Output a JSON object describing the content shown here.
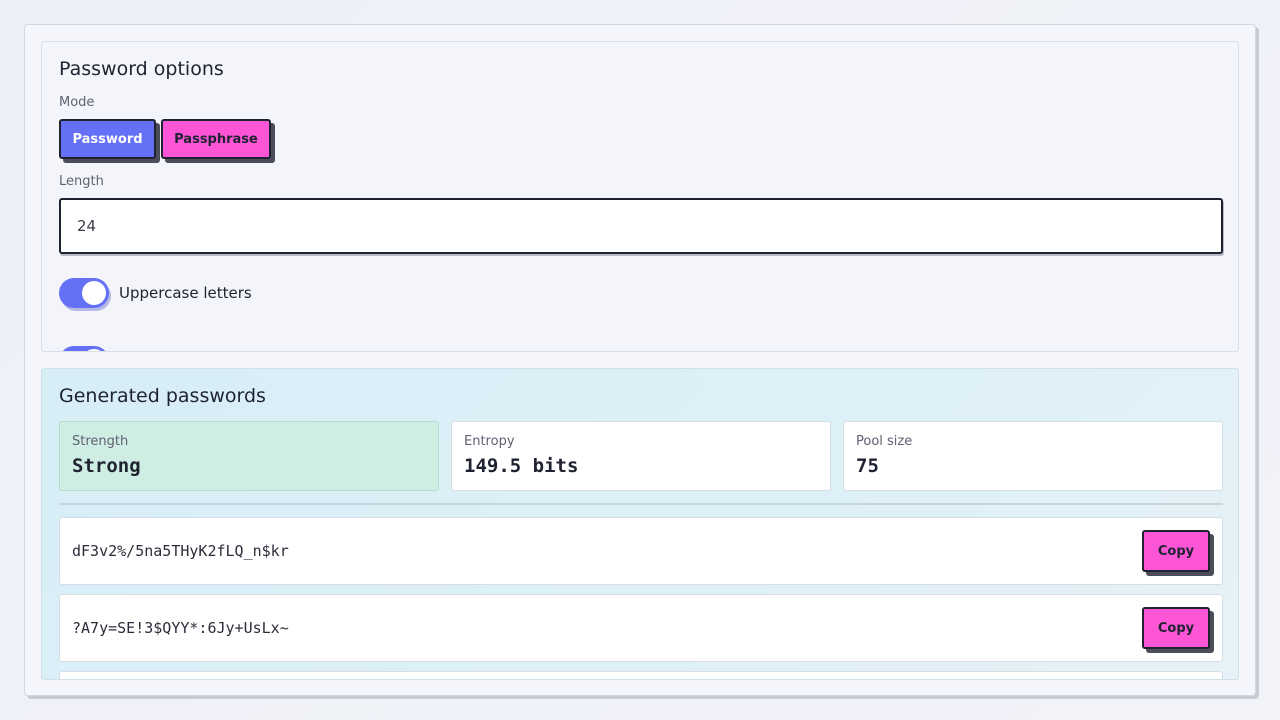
{
  "options": {
    "title": "Password options",
    "mode_label": "Mode",
    "mode_buttons": [
      "Password",
      "Passphrase"
    ],
    "length_label": "Length",
    "length_value": "24",
    "toggles": [
      {
        "label": "Uppercase letters",
        "on": true
      },
      {
        "label": "",
        "on": true
      }
    ]
  },
  "generated": {
    "title": "Generated passwords",
    "stats": [
      {
        "label": "Strength",
        "value": "Strong"
      },
      {
        "label": "Entropy",
        "value": "149.5 bits"
      },
      {
        "label": "Pool size",
        "value": "75"
      }
    ],
    "passwords": [
      "dF3v2%/5na5THyK2fLQ_n$kr",
      "?A7y=SE!3$QYY*:6Jy+UsLx~"
    ],
    "copy_label": "Copy"
  },
  "colors": {
    "accent": "#6470f6",
    "pink": "#fd55d6",
    "strong_bg": "#cfede3"
  }
}
